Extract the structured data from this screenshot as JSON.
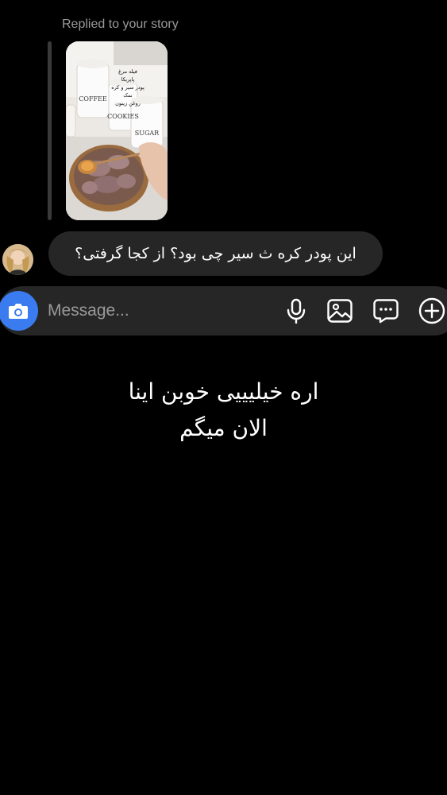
{
  "reply_context": {
    "label": "Replied to your story"
  },
  "story": {
    "overlay_lines": [
      "فیله مرغ",
      "پاپریکا",
      "پودر سیر و کره",
      "نمک",
      "روغن زیتون"
    ],
    "jar_labels": [
      "COFFEE",
      "COOKIES",
      "SUGAR"
    ]
  },
  "message": {
    "text": "این پودر کره ث سیر چی بود؟ از کجا گرفتی؟"
  },
  "composer": {
    "placeholder": "Message..."
  },
  "icons": {
    "camera": "camera-icon",
    "mic": "microphone-icon",
    "gallery": "gallery-icon",
    "sticker": "sticker-chat-icon",
    "add": "plus-circle-icon"
  },
  "overlay": {
    "line1": "اره خیلیییی خوبن اینا",
    "line2": "الان میگم"
  },
  "colors": {
    "background": "#000000",
    "bubble": "#262626",
    "accent": "#3a7bf0",
    "muted_text": "#9a9a9a"
  }
}
